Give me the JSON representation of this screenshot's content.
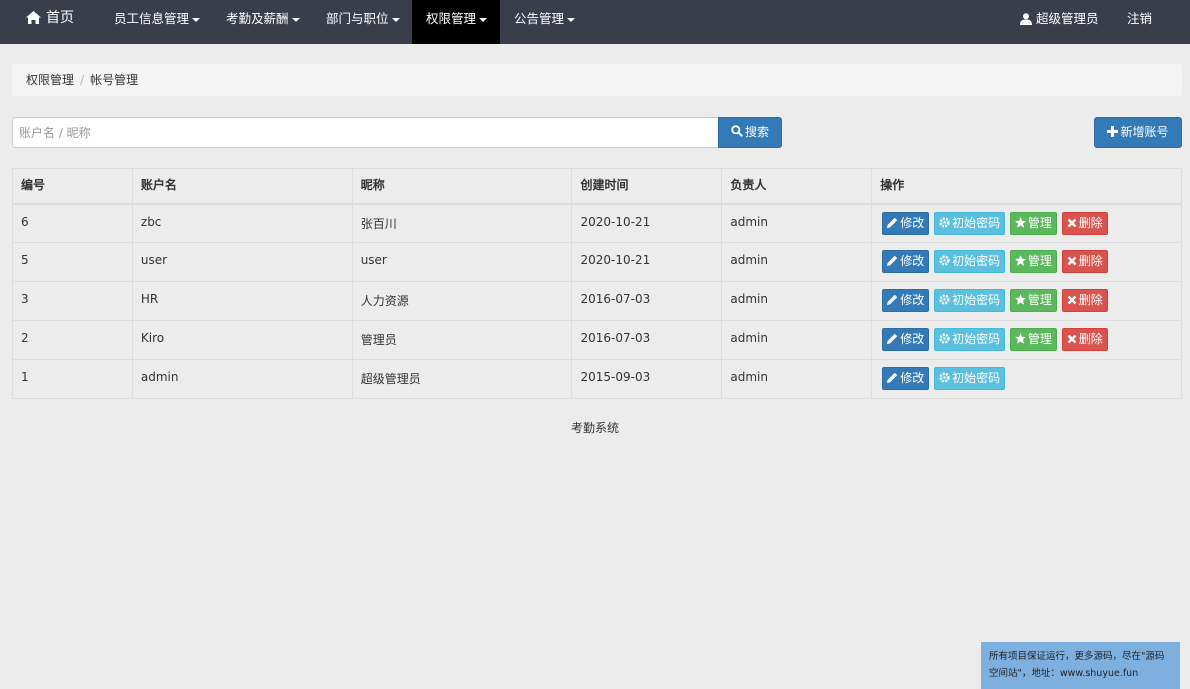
{
  "nav": {
    "home": "首页",
    "menus": [
      {
        "label": "员工信息管理"
      },
      {
        "label": "考勤及薪酬"
      },
      {
        "label": "部门与职位"
      },
      {
        "label": "权限管理"
      },
      {
        "label": "公告管理"
      }
    ],
    "user": "超级管理员",
    "logout": "注销"
  },
  "breadcrumb": {
    "parent": "权限管理",
    "separator": "/",
    "current": "帐号管理"
  },
  "search": {
    "placeholder": "账户名 / 昵称",
    "value": "",
    "button_label": "搜索"
  },
  "add_button": {
    "label": "新增账号"
  },
  "table": {
    "headers": [
      "编号",
      "账户名",
      "昵称",
      "创建时间",
      "负责人",
      "操作"
    ],
    "rows": [
      {
        "id": "6",
        "account": "zbc",
        "nickname": "张百川",
        "created": "2020-10-21",
        "owner": "admin"
      },
      {
        "id": "5",
        "account": "user",
        "nickname": "user",
        "created": "2020-10-21",
        "owner": "admin"
      },
      {
        "id": "3",
        "account": "HR",
        "nickname": "人力资源",
        "created": "2016-07-03",
        "owner": "admin"
      },
      {
        "id": "2",
        "account": "Kiro",
        "nickname": "管理员",
        "created": "2016-07-03",
        "owner": "admin"
      },
      {
        "id": "1",
        "account": "admin",
        "nickname": "超级管理员",
        "created": "2015-09-03",
        "owner": "admin"
      }
    ],
    "actions": {
      "edit": "修改",
      "reset_password": "初始密码",
      "manage": "管理",
      "delete": "删除"
    }
  },
  "footer": "考勤系统",
  "watermark": {
    "line1": "所有项目保证运行，更多源码，尽在\"源码",
    "line2": "空间站\"，地址：www.shuyue.fun"
  },
  "icons": {
    "home": "home-icon",
    "user": "user-icon",
    "search": "search-icon",
    "add": "plus-icon",
    "edit": "pencil-icon",
    "reset": "gear-icon",
    "manage": "star-icon",
    "delete": "x-icon"
  },
  "colors": {
    "navbar": "#3a3d4a",
    "primary": "#337ab7",
    "info": "#5bc0de",
    "success": "#5cb85c",
    "danger": "#d9534f"
  }
}
